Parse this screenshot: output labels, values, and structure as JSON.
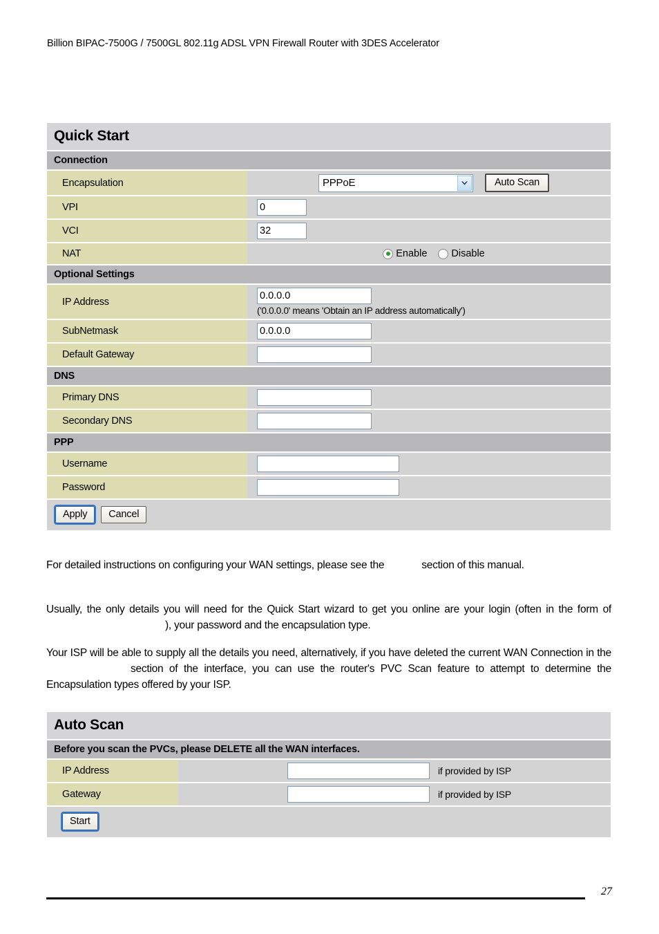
{
  "document": {
    "header": "Billion BIPAC-7500G / 7500GL 802.11g ADSL VPN Firewall Router with 3DES Accelerator",
    "page_number": "27"
  },
  "quick_start": {
    "title": "Quick Start",
    "sections": {
      "connection": "Connection",
      "optional": "Optional Settings",
      "dns": "DNS",
      "ppp": "PPP"
    },
    "encapsulation": {
      "label": "Encapsulation",
      "value": "PPPoE",
      "dropdown_icon": "chevron-down-icon",
      "auto_scan_button": "Auto Scan"
    },
    "vpi": {
      "label": "VPI",
      "value": "0"
    },
    "vci": {
      "label": "VCI",
      "value": "32"
    },
    "nat": {
      "label": "NAT",
      "enable_label": "Enable",
      "disable_label": "Disable",
      "selected": "Enable"
    },
    "ip_address": {
      "label": "IP Address",
      "value": "0.0.0.0",
      "hint": "('0.0.0.0' means 'Obtain an IP address automatically')"
    },
    "subnetmask": {
      "label": "SubNetmask",
      "value": "0.0.0.0"
    },
    "default_gateway": {
      "label": "Default Gateway",
      "value": ""
    },
    "primary_dns": {
      "label": "Primary DNS",
      "value": ""
    },
    "secondary_dns": {
      "label": "Secondary DNS",
      "value": ""
    },
    "username": {
      "label": "Username",
      "value": ""
    },
    "password": {
      "label": "Password",
      "value": ""
    },
    "apply_button": "Apply",
    "cancel_button": "Cancel"
  },
  "prose": {
    "p1_a": "For detailed instructions on configuring your WAN settings, please see the",
    "p1_b": "section of this manual.",
    "p2_a": "Usually, the only details you will need for the Quick Start wizard to get you online are your login (often in the form of",
    "p2_b": "), your password and the encapsulation type.",
    "p3_a": "Your ISP will be able to supply all the details you need, alternatively, if you have deleted the current WAN Connection in the",
    "p3_b": "section of the interface, you can use the router's PVC Scan feature to attempt to determine the Encapsulation types offered by your ISP."
  },
  "auto_scan": {
    "title": "Auto Scan",
    "notice": "Before you scan the PVCs, please DELETE all the WAN interfaces.",
    "ip_address": {
      "label": "IP Address",
      "value": "",
      "note": "if provided by ISP"
    },
    "gateway": {
      "label": "Gateway",
      "value": "",
      "note": "if provided by ISP"
    },
    "start_button": "Start"
  },
  "colors": {
    "label_cell": "#dcdcb0",
    "value_cell": "#d3d3d3",
    "section_head": "#b8b8bb",
    "panel_title": "#d5d5d7",
    "input_border": "#7f9db9",
    "radio_selected": "#2e9b2e"
  }
}
